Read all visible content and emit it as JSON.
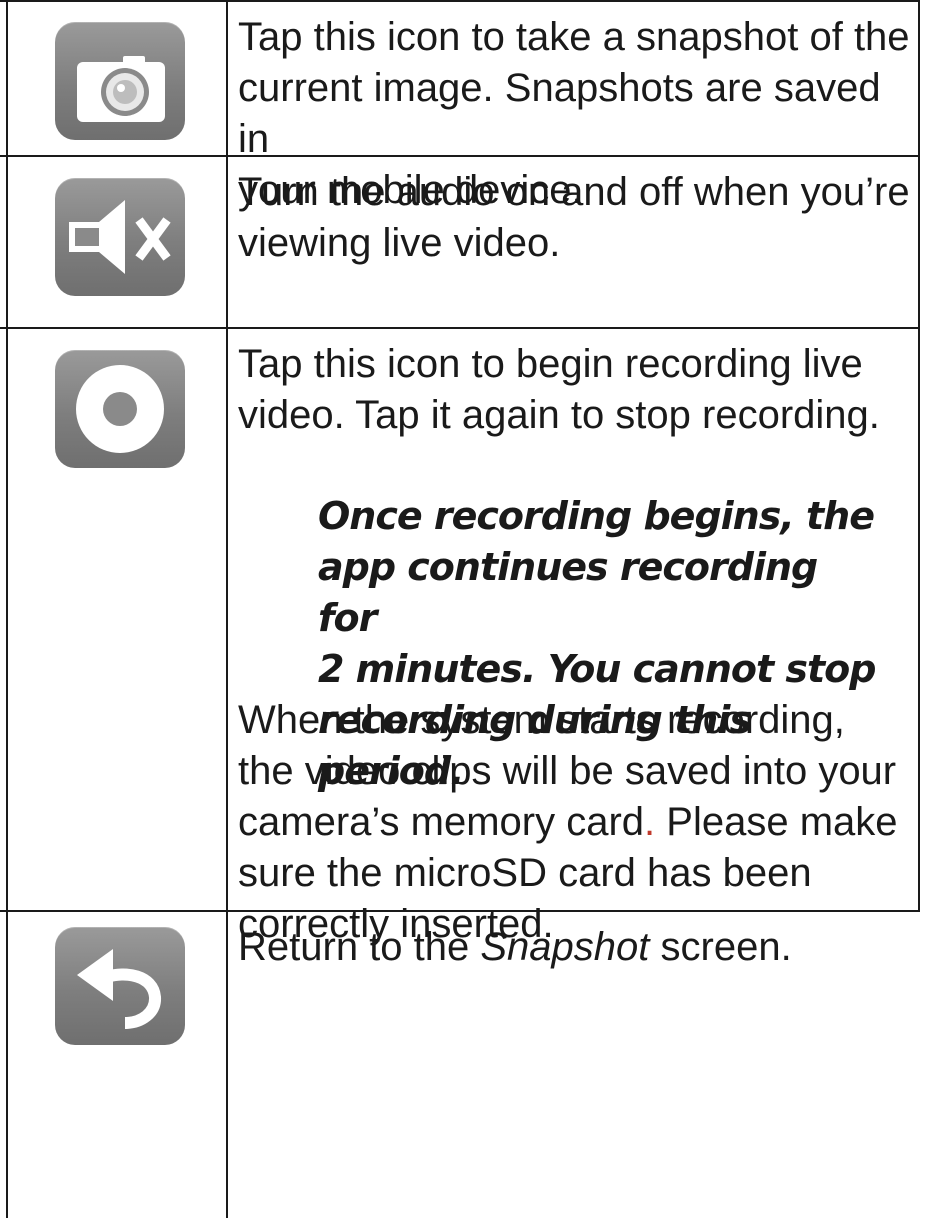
{
  "rows": [
    {
      "icon": "camera-icon",
      "lines": [
        "Tap this icon to take a snapshot of the",
        "current image. Snapshots are saved in",
        "your mobile device."
      ]
    },
    {
      "icon": "mute-speaker-icon",
      "lines": [
        "Turn the audio on and off when you’re",
        "viewing live video."
      ]
    },
    {
      "icon": "record-icon",
      "lines": [
        "Tap this icon to begin recording live",
        "video. Tap it again to stop recording."
      ],
      "note_lines": [
        "Once recording begins, the",
        "app continues recording for",
        "2 minutes. You cannot stop",
        "recording during this period."
      ],
      "after_lines": [
        "When the system starts recording,",
        "the video clips will be saved into your",
        "camera’s memory card",
        ".",
        " Please make",
        "sure the microSD card has been",
        "correctly inserted."
      ]
    },
    {
      "icon": "return-arrow-icon",
      "prefix": "Return to the ",
      "emphasis": "Snapshot",
      "suffix": " screen."
    }
  ],
  "colors": {
    "text": "#1a1a1a",
    "icon_bg": "#808080",
    "accent_period": "#c0392b"
  }
}
